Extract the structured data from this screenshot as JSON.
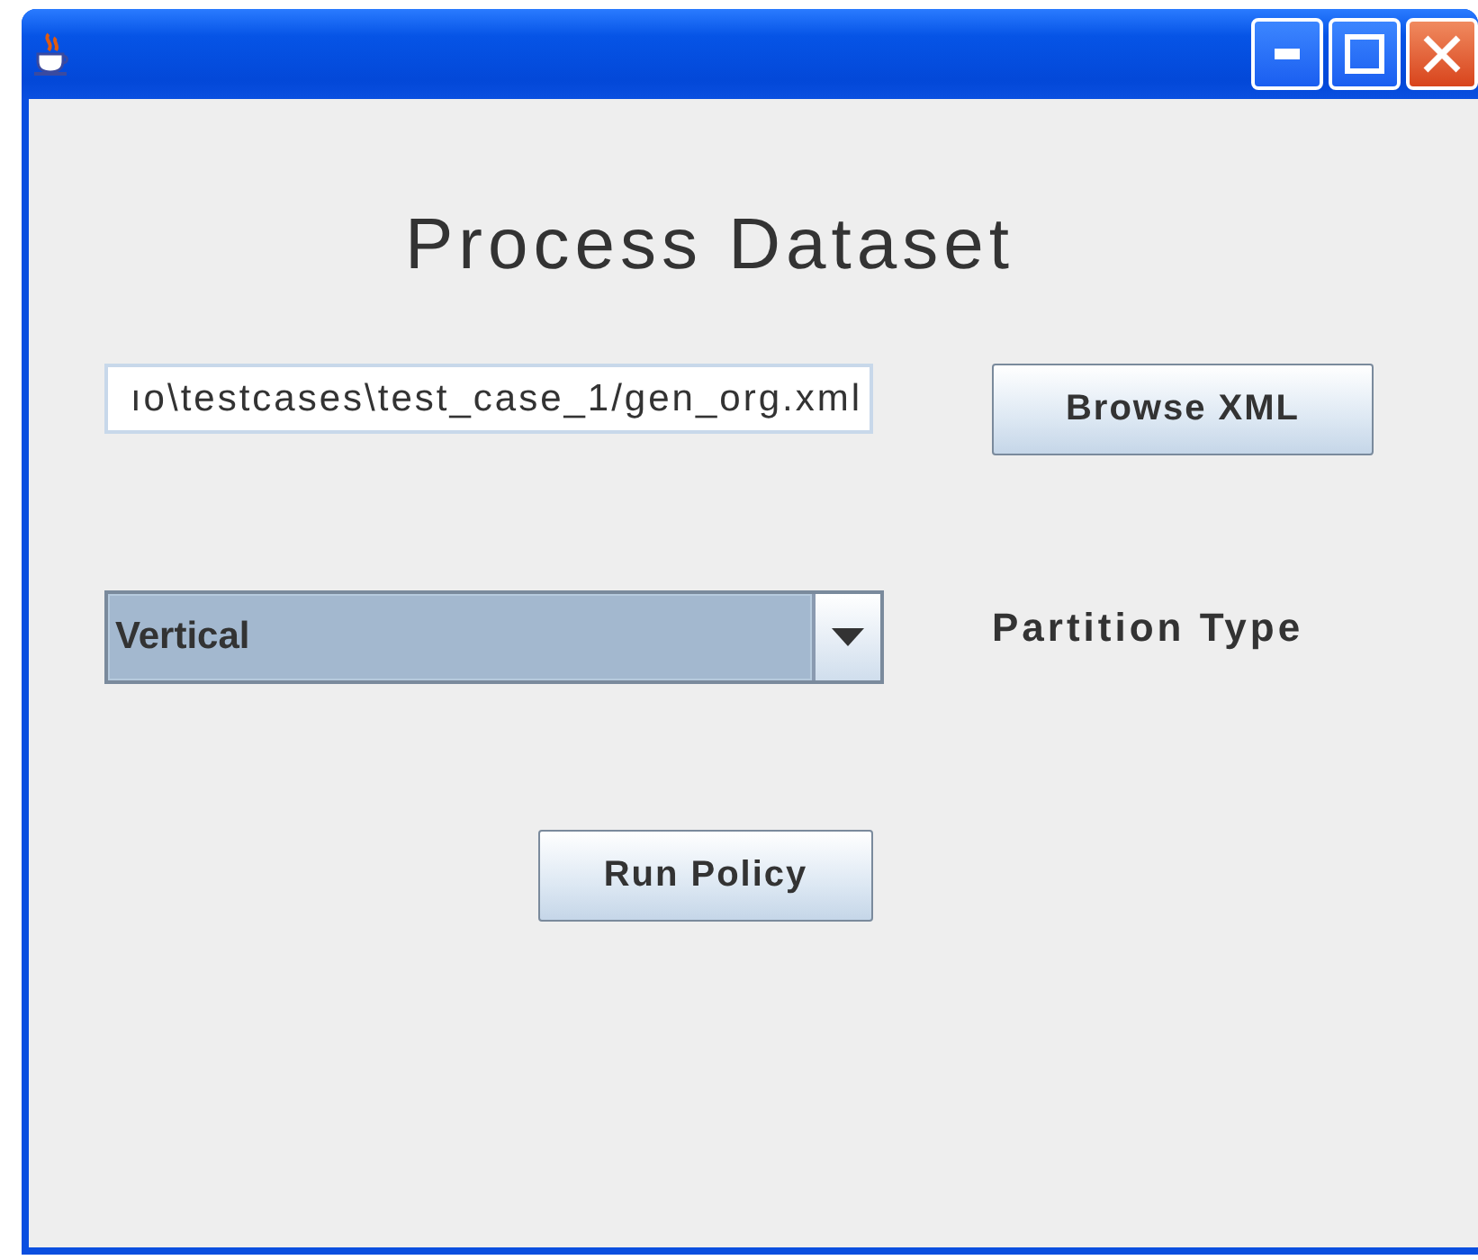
{
  "heading": "Process Dataset",
  "file_field": {
    "value": "ıo\\testcases\\test_case_1/gen_org.xml"
  },
  "browse_button": "Browse XML",
  "partition_combo": {
    "value": "Vertical",
    "focused": true
  },
  "partition_label": "Partition Type",
  "run_button": "Run Policy"
}
